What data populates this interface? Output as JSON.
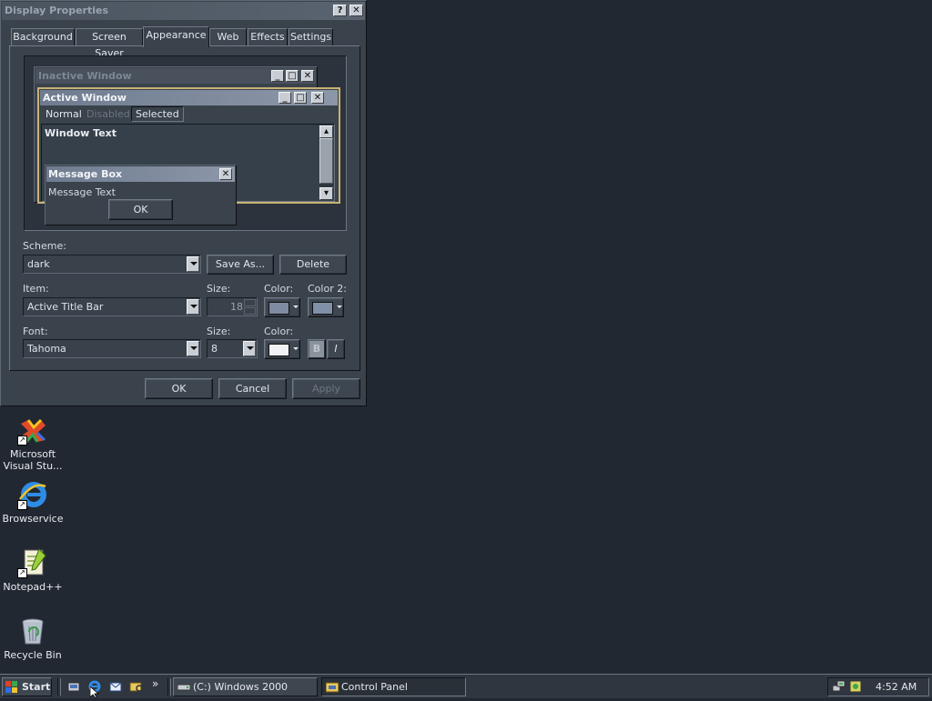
{
  "dialog": {
    "title": "Display Properties",
    "help_glyph": "?",
    "close_glyph": "✕",
    "tabs": [
      "Background",
      "Screen Saver",
      "Appearance",
      "Web",
      "Effects",
      "Settings"
    ],
    "active_tab": "Appearance",
    "preview": {
      "inactive_title": "Inactive Window",
      "active_title": "Active Window",
      "menu": [
        "Normal",
        "Disabled",
        "Selected"
      ],
      "window_text": "Window Text",
      "message_box_title": "Message Box",
      "message_text": "Message Text",
      "ok": "OK"
    },
    "scheme": {
      "label": "Scheme:",
      "value": "dark",
      "save_as": "Save As...",
      "delete": "Delete"
    },
    "item": {
      "label": "Item:",
      "value": "Active Title Bar",
      "size_label": "Size:",
      "size_value": "18",
      "color_label": "Color:",
      "color2_label": "Color 2:",
      "color_hex": "#7f8ba0",
      "color2_hex": "#8090a8"
    },
    "font": {
      "label": "Font:",
      "value": "Tahoma",
      "size_label": "Size:",
      "size_value": "8",
      "color_label": "Color:",
      "color_hex": "#f0f2f6",
      "bold": "B",
      "italic": "I"
    },
    "buttons": {
      "ok": "OK",
      "cancel": "Cancel",
      "apply": "Apply"
    }
  },
  "desktop_icons": [
    {
      "label": "Microsoft Visual Stu...",
      "icon": "visual-studio-icon"
    },
    {
      "label": "Browservice",
      "icon": "internet-explorer-icon"
    },
    {
      "label": "Notepad++",
      "icon": "notepad-plus-plus-icon"
    },
    {
      "label": "Recycle Bin",
      "icon": "recycle-bin-icon"
    }
  ],
  "taskbar": {
    "start": "Start",
    "chevron": "»",
    "tasks": [
      {
        "label": "(C:) Windows 2000",
        "icon": "drive-icon"
      },
      {
        "label": "Control Panel",
        "icon": "control-panel-icon"
      }
    ],
    "clock": "4:52 AM"
  }
}
